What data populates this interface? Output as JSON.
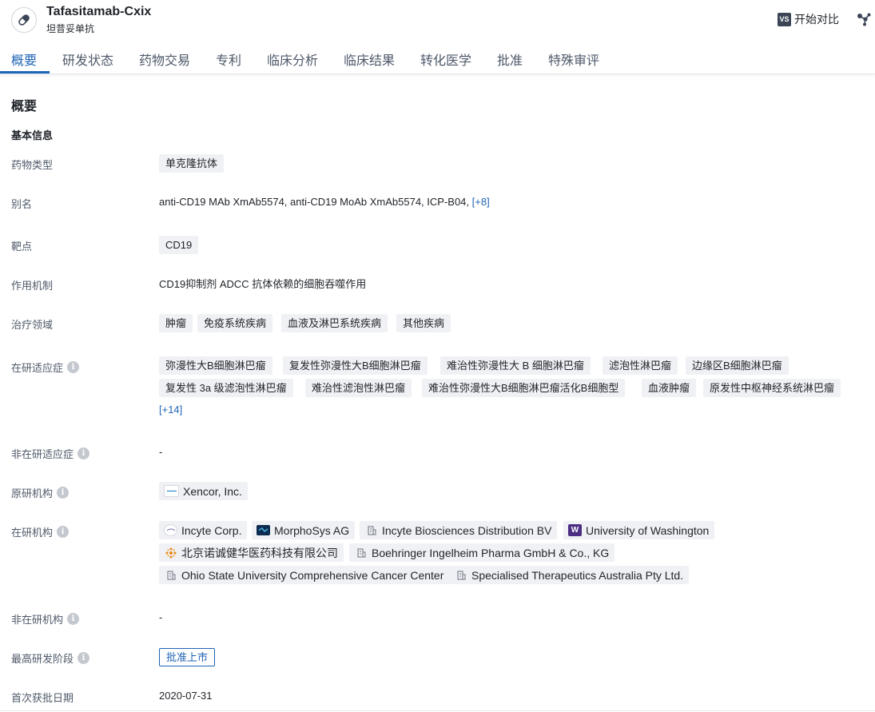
{
  "header": {
    "title": "Tafasitamab-Cxix",
    "subtitle": "坦昔妥单抗",
    "compare_badge": "VS",
    "compare_label": "开始对比"
  },
  "tabs": [
    "概要",
    "研发状态",
    "药物交易",
    "专利",
    "临床分析",
    "临床结果",
    "转化医学",
    "批准",
    "特殊审评"
  ],
  "section_title": "概要",
  "basic_info_title": "基本信息",
  "fields": {
    "drug_type": {
      "label": "药物类型",
      "tags": [
        "单克隆抗体"
      ]
    },
    "aliases": {
      "label": "别名",
      "text": "anti-CD19 MAb XmAb5574,  anti-CD19 MoAb XmAb5574,  ICP-B04,",
      "more": "[+8]"
    },
    "target": {
      "label": "靶点",
      "tags": [
        "CD19"
      ]
    },
    "mechanism": {
      "label": "作用机制",
      "text": "CD19抑制剂  ADCC  抗体依赖的细胞吞噬作用"
    },
    "therapeutic_area": {
      "label": "治疗领域",
      "tags": [
        "肿瘤",
        "免疫系统疾病",
        "血液及淋巴系统疾病",
        "其他疾病"
      ]
    },
    "indications": {
      "label": "在研适应症",
      "tags": [
        "弥漫性大B细胞淋巴瘤",
        "复发性弥漫性大B细胞淋巴瘤",
        "难治性弥漫性大 B 细胞淋巴瘤",
        "滤泡性淋巴瘤",
        "边缘区B细胞淋巴瘤",
        "复发性 3a 级滤泡性淋巴瘤",
        "难治性滤泡性淋巴瘤",
        "难治性弥漫性大B细胞淋巴瘤活化B细胞型",
        "血液肿瘤",
        "原发性中枢神经系统淋巴瘤"
      ],
      "more": "[+14]"
    },
    "inactive_indications": {
      "label": "非在研适应症",
      "text": "-"
    },
    "originator": {
      "label": "原研机构",
      "orgs": [
        {
          "name": "Xencor, Inc.",
          "logo": "xencor-logo"
        }
      ]
    },
    "active_orgs": {
      "label": "在研机构",
      "orgs": [
        {
          "name": "Incyte Corp.",
          "logo": "incyte-logo"
        },
        {
          "name": "MorphoSys AG",
          "logo": "morphosys-logo"
        },
        {
          "name": "Incyte Biosciences Distribution BV",
          "logo": "building-icon"
        },
        {
          "name": "University of Washington",
          "logo": "uw-logo",
          "logo_text": "W"
        },
        {
          "name": "北京诺诚健华医药科技有限公司",
          "logo": "innocare-logo"
        },
        {
          "name": "Boehringer Ingelheim Pharma GmbH & Co., KG",
          "logo": "building-icon"
        },
        {
          "name": "Ohio State University Comprehensive Cancer Center",
          "logo": "building-icon"
        },
        {
          "name": "Specialised Therapeutics Australia Pty Ltd.",
          "logo": "building-icon"
        }
      ]
    },
    "inactive_orgs": {
      "label": "非在研机构",
      "text": "-"
    },
    "highest_phase": {
      "label": "最高研发阶段",
      "badge": "批准上市"
    },
    "first_approval": {
      "label": "首次获批日期",
      "text": "2020-07-31"
    }
  },
  "colors": {
    "accent": "#1e64b4",
    "tag_bg": "#f0f1f4",
    "uw_purple": "#4b2e83"
  }
}
